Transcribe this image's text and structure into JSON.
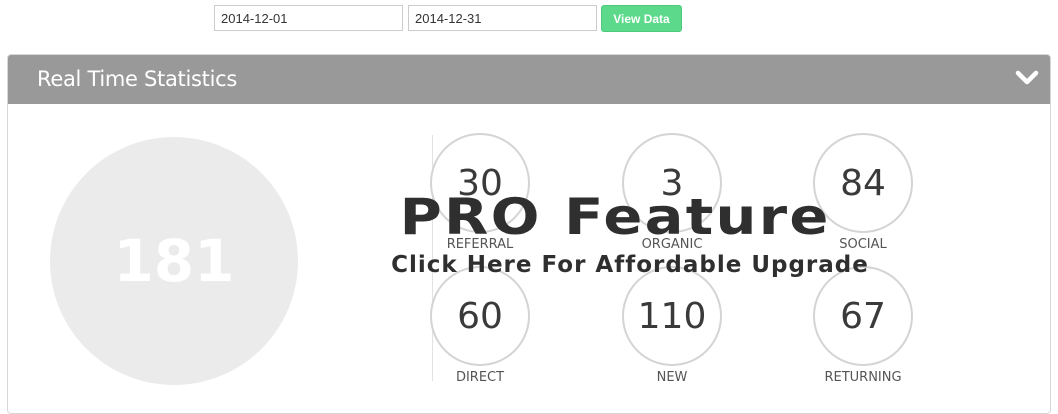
{
  "filters": {
    "date_from": "2014-12-01",
    "date_to": "2014-12-31",
    "view_button_label": "View Data",
    "accent_color": "#5cd98b"
  },
  "panel": {
    "title": "Real Time Statistics",
    "header_color": "#999999",
    "collapse_icon": "chevron-down-icon",
    "total_value": "181",
    "stats": [
      {
        "value": "30",
        "label": "REFERRAL"
      },
      {
        "value": "3",
        "label": "ORGANIC"
      },
      {
        "value": "84",
        "label": "SOCIAL"
      },
      {
        "value": "60",
        "label": "DIRECT"
      },
      {
        "value": "110",
        "label": "NEW"
      },
      {
        "value": "67",
        "label": "RETURNING"
      }
    ]
  },
  "promo": {
    "title": "PRO Feature",
    "link_text": "Click Here For Affordable Upgrade"
  }
}
